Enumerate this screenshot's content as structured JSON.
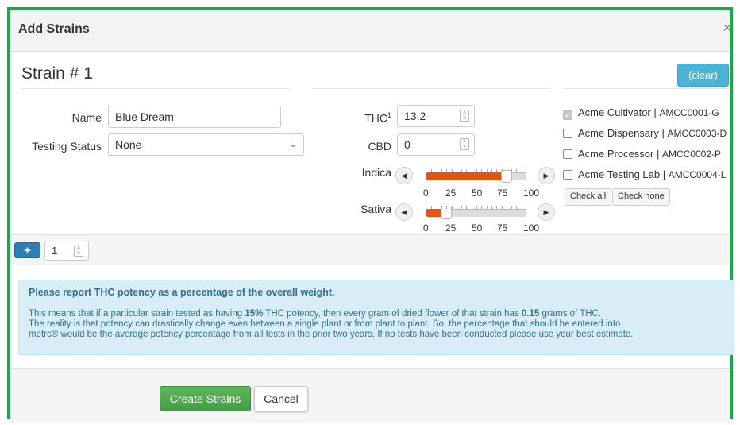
{
  "dialog": {
    "title": "Add Strains",
    "close_glyph": "×"
  },
  "strain": {
    "heading": "Strain # 1",
    "clear_label": "(clear)",
    "name_label": "Name",
    "name_value": "Blue Dream",
    "testing_status_label": "Testing Status",
    "testing_status_value": "None",
    "thc_label": "THC",
    "thc_footnote": "1",
    "thc_value": "13.2",
    "cbd_label": "CBD",
    "cbd_value": "0",
    "indica_label": "Indica",
    "indica_percent": 80,
    "sativa_label": "Sativa",
    "sativa_percent": 20,
    "scale_labels": [
      "0",
      "25",
      "50",
      "75",
      "100"
    ]
  },
  "facilities": {
    "items": [
      {
        "name": "Acme Cultivator",
        "code": "AMCC0001-G",
        "checked": true
      },
      {
        "name": "Acme Dispensary",
        "code": "AMCC0003-D",
        "checked": false
      },
      {
        "name": "Acme Processor",
        "code": "AMCC0002-P",
        "checked": false
      },
      {
        "name": "Acme Testing Lab",
        "code": "AMCC0004-L",
        "checked": false
      }
    ],
    "separator": " | ",
    "check_all_label": "Check all",
    "check_none_label": "Check none"
  },
  "add_row": {
    "plus_glyph": "+",
    "count_value": "1"
  },
  "info": {
    "heading": "Please report THC potency as a percentage of the overall weight.",
    "line1_pre": "This means that if a particular strain tested as having ",
    "line1_b1": "15%",
    "line1_mid": " THC potency, then every gram of dried flower of that strain has ",
    "line1_b2": "0.15",
    "line1_post": " grams of THC.",
    "line2": "The reality is that potency can drastically change even between a single plant or from plant to plant. So, the percentage that should be entered into",
    "line3": "metrc® would be the average potency percentage from all tests in the prior two years. If no tests have been conducted please use your best estimate."
  },
  "footer": {
    "create_label": "Create Strains",
    "cancel_label": "Cancel"
  },
  "colors": {
    "frame_border": "#1ba84a",
    "slider_fill": "#e8530f",
    "clear_button": "#4bb3d6",
    "create_button": "#5cb85c",
    "info_text": "#31708f"
  }
}
